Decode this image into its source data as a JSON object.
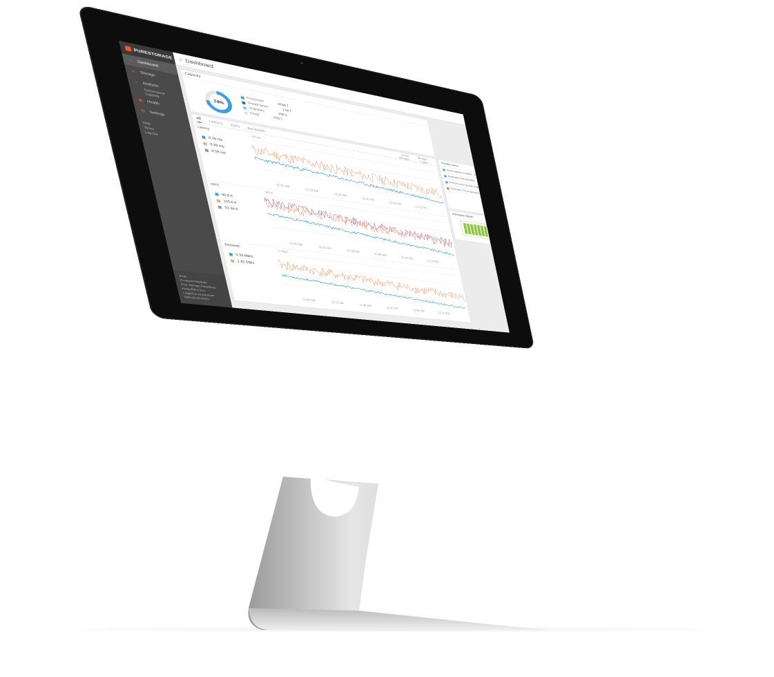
{
  "colors": {
    "accent": "#f05a28",
    "read": "#3aa0e0",
    "write": "#f5a57a",
    "mirrored": "#9a86c8",
    "sidebar": "#4a4a4a",
    "screen_bg": "#ececec",
    "bar_green": "#8cc63f"
  },
  "app": {
    "logo_text": "PURESTORAGE",
    "page_title": "Dashboard"
  },
  "sidebar": {
    "items": [
      {
        "label": "Dashboard",
        "icon": "dashboard-icon"
      },
      {
        "label": "Storage",
        "icon": "storage-icon"
      },
      {
        "label": "Analysis",
        "icon": "analysis-icon"
      },
      {
        "label": "Health",
        "icon": "health-icon"
      },
      {
        "label": "Settings",
        "icon": "settings-icon"
      }
    ],
    "analysis_sub": [
      "Performance",
      "Capacity"
    ],
    "utility": [
      "Help",
      "Terms",
      "Log Out"
    ],
    "footer": [
      "Array",
      "m-vagrant-fastpath",
      "Pure Storage FlashArray",
      "Purity//FA 4.10.x",
      "Logged in as pureuser",
      "GMT-05:00 (PST)"
    ]
  },
  "capacity": {
    "title": "Capacity",
    "percent_label": "74%",
    "percent_value": 0.74,
    "legend": [
      {
        "label": "Provisioned",
        "value": "39.68 T",
        "color": "#3aa0e0"
      },
      {
        "label": "Shared Space",
        "value": "1.09 T",
        "color": "#2b6cb0"
      },
      {
        "label": "Snapshots",
        "value": "139 G",
        "color": "#7fc4ef"
      },
      {
        "label": "Empty",
        "value": "9.91 T",
        "color": "#e0e0e0"
      }
    ]
  },
  "perf": {
    "tabs": [
      "All",
      "Latency",
      "IOPS",
      "Bandwidth"
    ],
    "active_tab": "All",
    "range_labels": [
      "1 hour",
      "24 hours",
      "30 days",
      "1 year"
    ],
    "latency": {
      "label": "Latency",
      "values": [
        "0.20 ms",
        "0.26 ms",
        "0.58 ms"
      ],
      "value_colors": [
        "#3aa0e0",
        "#f5a57a",
        "#9a86c8"
      ],
      "sub": "20 ms",
      "times": [
        "11:00 AM",
        "11:15 AM",
        "11:30 AM",
        "11:45 AM",
        "12:00 PM",
        "12:15 PM"
      ]
    },
    "iops": {
      "label": "IOPS",
      "values": [
        "90.8 K",
        "103.6 K",
        "51.34 K"
      ],
      "value_colors": [
        "#3aa0e0",
        "#f5a57a",
        "#9a86c8"
      ],
      "sub": "100 K",
      "times": [
        "11:00 AM",
        "11:15 AM",
        "11:30 AM",
        "11:45 AM",
        "12:00 PM",
        "12:15 PM"
      ]
    },
    "bandwidth": {
      "label": "Bandwidth",
      "values": [
        "0.33 MB/s",
        "1.42 GB/s"
      ],
      "value_colors": [
        "#3aa0e0",
        "#f5a57a"
      ],
      "sub": "2 GB/s",
      "times": [
        "11:00 AM",
        "11:15 AM",
        "11:30 AM",
        "11:45 AM",
        "12:00 PM",
        "12:15 PM"
      ]
    }
  },
  "alerts": {
    "title": "Recent Alerts",
    "items": [
      {
        "text": "Purity upgrade available - 4.10.6",
        "color": "#3aa0e0"
      },
      {
        "text": "Replication link degraded",
        "color": "#3aa0e0"
      },
      {
        "text": "Remote assist session expired",
        "color": "#3aa0e0"
      },
      {
        "text": "Controller CT1 temperature warning",
        "color": "#f05a28"
      }
    ]
  },
  "hardware": {
    "title": "Hardware Health"
  }
}
